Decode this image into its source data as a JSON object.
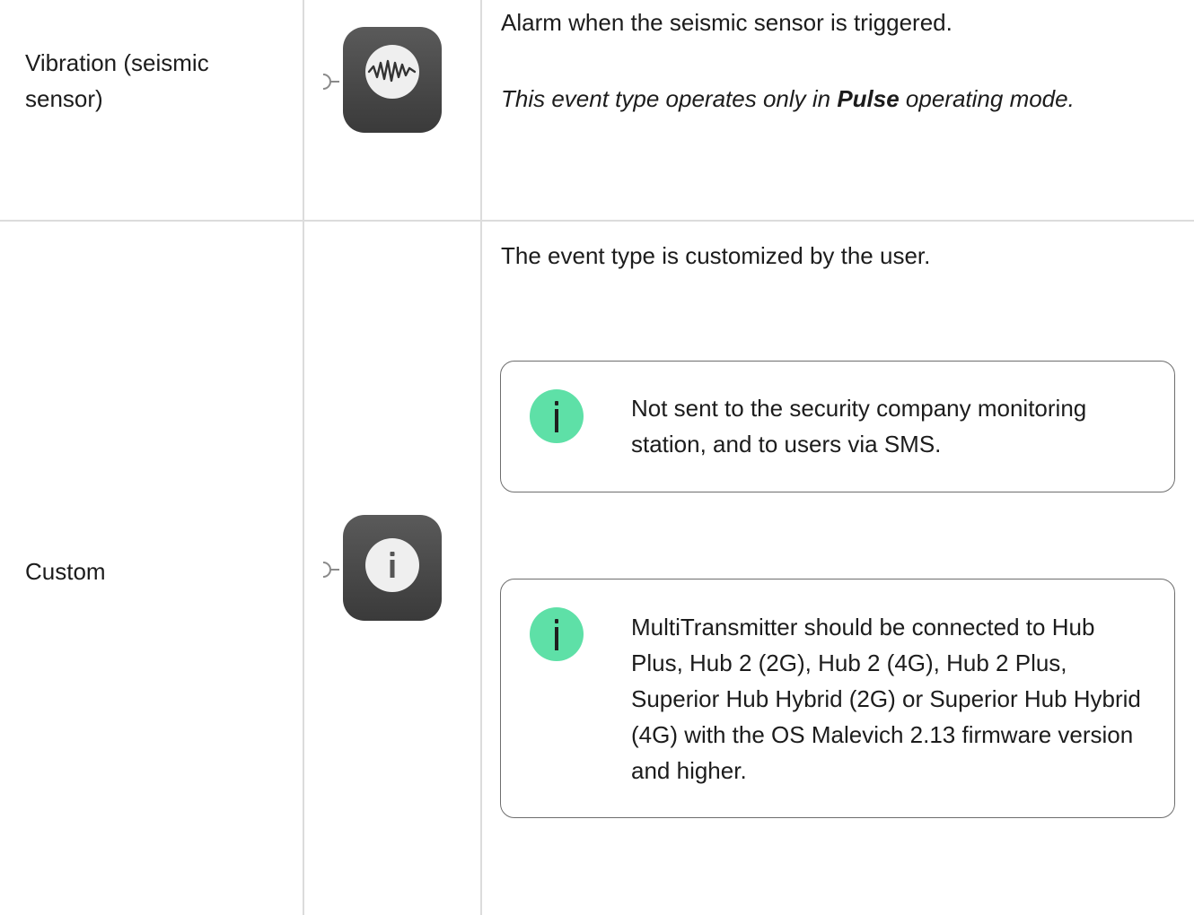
{
  "rows": [
    {
      "event_label": "Vibration (seismic sensor)",
      "icon": "seismic-wave-icon",
      "description": "Alarm when the seismic sensor is triggered.",
      "mode_note": {
        "prefix": "This event type operates only in ",
        "mode": "Pulse",
        "suffix": " operating mode."
      }
    },
    {
      "event_label": "Custom",
      "icon": "info-icon",
      "description": "The event type is customized by the user.",
      "notes": [
        {
          "icon": "info-icon",
          "text": "Not sent to the security company monitoring station, and to users via SMS."
        },
        {
          "icon": "info-icon",
          "text": "MultiTransmitter should be connected to Hub Plus, Hub 2 (2G), Hub 2 (4G), Hub 2 Plus, Superior Hub Hybrid (2G) or Superior Hub Hybrid (4G) with the OS Malevich 2.13 firmware version and higher."
        }
      ]
    }
  ],
  "colors": {
    "border": "#dcdcdc",
    "note_border": "#6e6e6e",
    "note_icon_bg": "#5ee0a7",
    "device_icon_bg": "#4a4a4a",
    "device_icon_face": "#efefef"
  }
}
